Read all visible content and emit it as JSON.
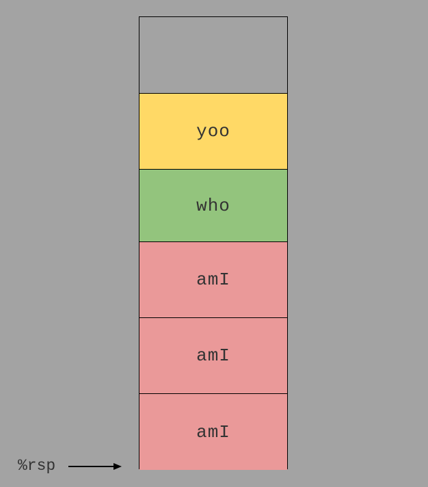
{
  "diagram": {
    "frames": [
      {
        "label": "",
        "color": "#a3a3a3"
      },
      {
        "label": "yoo",
        "color": "#ffd966"
      },
      {
        "label": "who",
        "color": "#93c47d"
      },
      {
        "label": "amI",
        "color": "#ea9999"
      },
      {
        "label": "amI",
        "color": "#ea9999"
      },
      {
        "label": "amI",
        "color": "#ea9999"
      }
    ],
    "pointer": {
      "label": "%rsp"
    }
  }
}
